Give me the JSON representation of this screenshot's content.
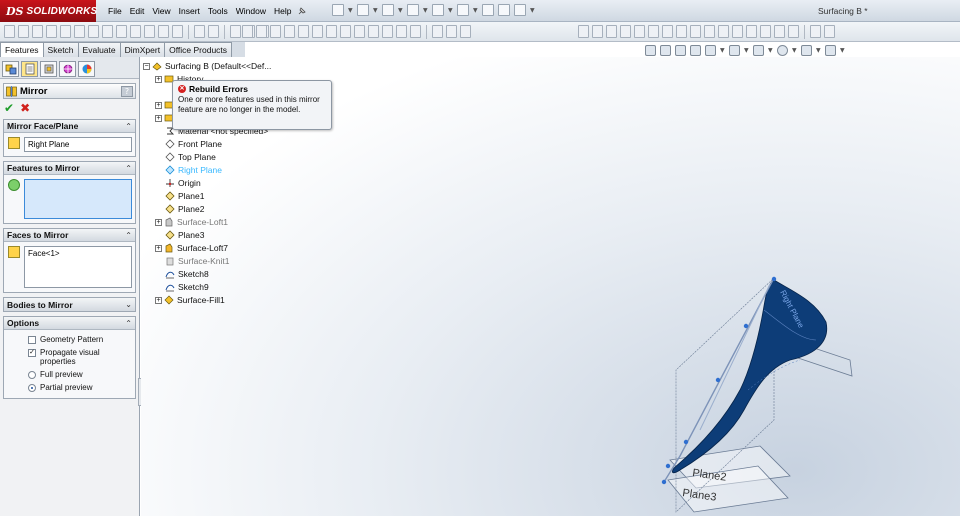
{
  "app": {
    "logo_ds": "DS",
    "logo_text": "SOLIDWORKS",
    "document_title": "Surfacing B *"
  },
  "menu": [
    "File",
    "Edit",
    "View",
    "Insert",
    "Tools",
    "Window",
    "Help"
  ],
  "command_tabs": [
    "Features",
    "Sketch",
    "Evaluate",
    "DimXpert",
    "Office Products"
  ],
  "property_manager": {
    "title": "Mirror",
    "help": "?",
    "ok": "✔",
    "cancel": "✖",
    "groups": {
      "mirror_plane": {
        "title": "Mirror Face/Plane",
        "value": "Right Plane"
      },
      "features": {
        "title": "Features to Mirror",
        "value": ""
      },
      "faces": {
        "title": "Faces to Mirror",
        "value": "Face<1>"
      },
      "bodies": {
        "title": "Bodies to Mirror"
      },
      "options": {
        "title": "Options",
        "geometry_pattern": "Geometry Pattern",
        "propagate": "Propagate visual properties",
        "full_preview": "Full preview",
        "partial_preview": "Partial preview"
      }
    }
  },
  "tree": {
    "root": "Surfacing B  (Default<<Def...",
    "items": {
      "history": "History",
      "material": "Material <not specified>",
      "front_plane": "Front Plane",
      "top_plane": "Top Plane",
      "right_plane": "Right Plane",
      "origin": "Origin",
      "plane1": "Plane1",
      "plane2": "Plane2",
      "surface_loft1": "Surface-Loft1",
      "plane3": "Plane3",
      "surface_loft7": "Surface-Loft7",
      "surface_knit1": "Surface-Knit1",
      "sketch8": "Sketch8",
      "sketch9": "Sketch9",
      "surface_fill1": "Surface-Fill1"
    }
  },
  "tooltip": {
    "title": "Rebuild Errors",
    "message": "One or more features used in this mirror feature are no longer in the model."
  },
  "viewport_labels": {
    "right_plane": "Right Plane",
    "plane2": "Plane2",
    "plane3": "Plane3"
  },
  "colors": {
    "accent_red": "#c9141b",
    "surface_blue": "#0b3f7a",
    "highlight_cyan": "#38b8ff"
  }
}
